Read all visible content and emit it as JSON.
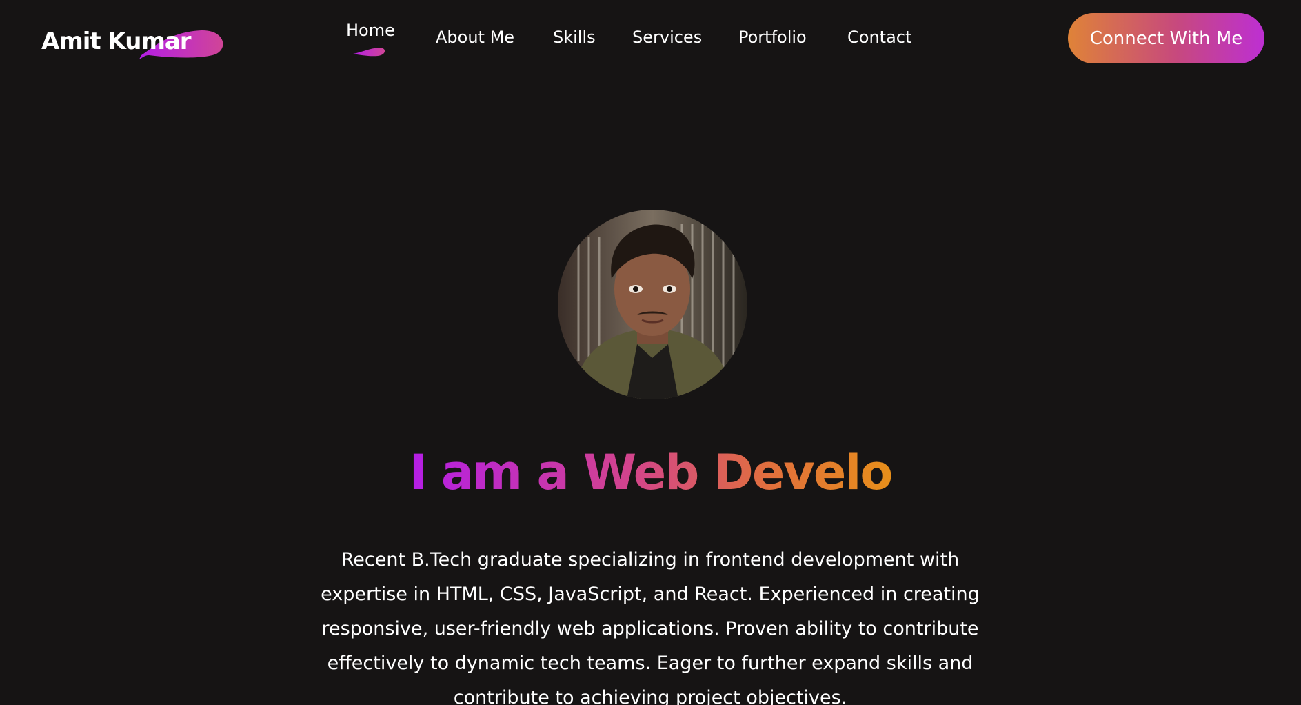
{
  "header": {
    "logo_text": "Amit Kumar",
    "nav_items": [
      {
        "label": "Home",
        "active": true
      },
      {
        "label": "About Me"
      },
      {
        "label": "Skills"
      },
      {
        "label": "Services"
      },
      {
        "label": "Portfolio"
      },
      {
        "label": "Contact"
      }
    ],
    "cta_label": "Connect With Me"
  },
  "hero": {
    "headline": "I am a Web Develo",
    "bio": "Recent B.Tech graduate specializing in frontend development with expertise in HTML, CSS, JavaScript, and React. Experienced in creating responsive, user-friendly web applications. Proven ability to contribute effectively to dynamic tech teams. Eager to further expand skills and contribute to achieving project objectives."
  },
  "colors": {
    "background": "#161414",
    "gradient_start": "#b41ee6",
    "gradient_mid": "#d2438e",
    "gradient_end": "#e78f1a",
    "cta_start": "#df8338",
    "cta_end": "#bd2fd3"
  }
}
